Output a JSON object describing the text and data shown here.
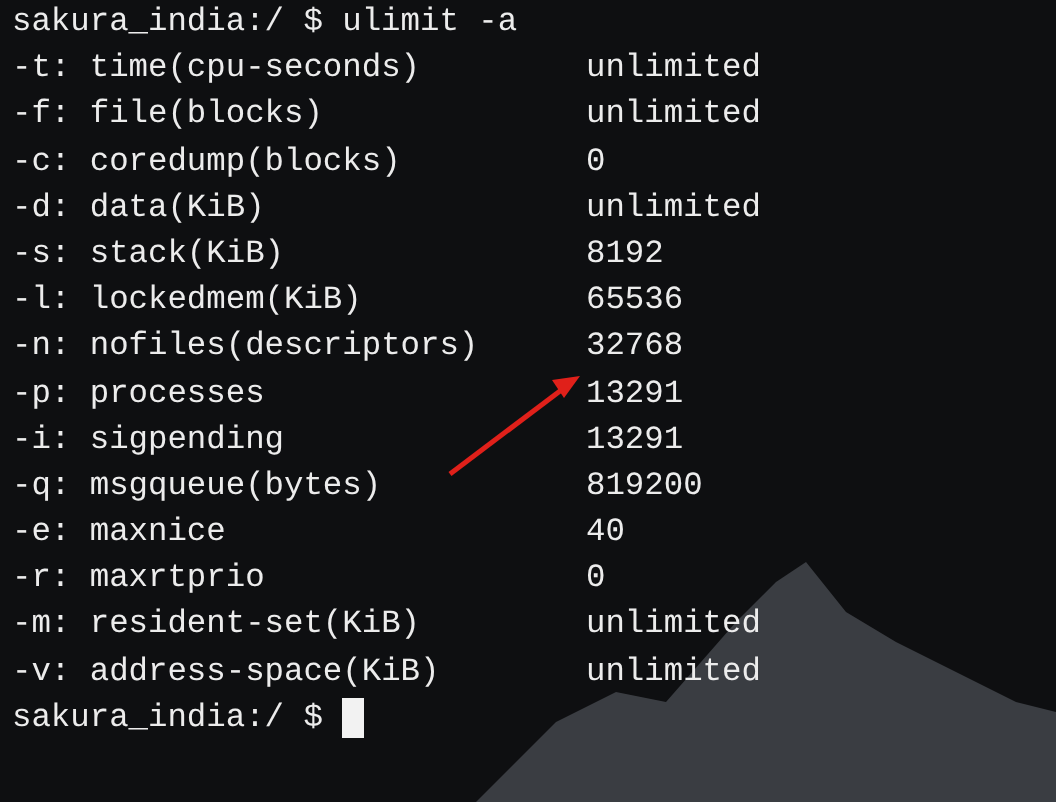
{
  "terminal": {
    "command_line": {
      "prompt": "sakura_india:/ $",
      "command": "ulimit -a"
    },
    "rows": [
      {
        "label": "-t: time(cpu-seconds)",
        "value": "unlimited"
      },
      {
        "label": "-f: file(blocks)",
        "value": "unlimited"
      },
      {
        "label": "-c: coredump(blocks)",
        "value": "0"
      },
      {
        "label": "-d: data(KiB)",
        "value": "unlimited"
      },
      {
        "label": "-s: stack(KiB)",
        "value": "8192"
      },
      {
        "label": "-l: lockedmem(KiB)",
        "value": "65536"
      },
      {
        "label": "-n: nofiles(descriptors)",
        "value": "32768"
      },
      {
        "label": "-p: processes",
        "value": "13291"
      },
      {
        "label": "-i: sigpending",
        "value": "13291"
      },
      {
        "label": "-q: msgqueue(bytes)",
        "value": "819200"
      },
      {
        "label": "-e: maxnice",
        "value": "40"
      },
      {
        "label": "-r: maxrtprio",
        "value": "0"
      },
      {
        "label": "-m: resident-set(KiB)",
        "value": "unlimited"
      },
      {
        "label": "-v: address-space(KiB)",
        "value": "unlimited"
      }
    ],
    "input_line": {
      "prompt": "sakura_india:/ $",
      "cursor_visible": true
    }
  }
}
